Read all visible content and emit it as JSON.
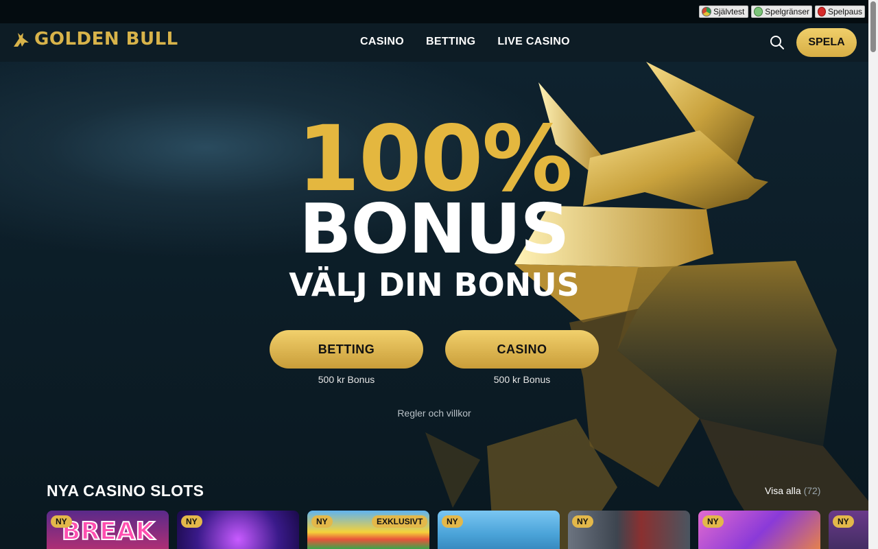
{
  "responsible_gaming": {
    "items": [
      {
        "label": "Självtest",
        "icon": "gauge-icon"
      },
      {
        "label": "Spelgränser",
        "icon": "limits-icon"
      },
      {
        "label": "Spelpaus",
        "icon": "pause-icon"
      }
    ]
  },
  "header": {
    "logo_text": "GOLDEN BULL",
    "nav": [
      "CASINO",
      "BETTING",
      "LIVE CASINO"
    ],
    "cta": "SPELA"
  },
  "hero": {
    "headline": "100%",
    "headline2": "BONUS",
    "subheadline": "VÄLJ DIN BONUS",
    "options": [
      {
        "label": "BETTING",
        "sub": "500 kr Bonus"
      },
      {
        "label": "CASINO",
        "sub": "500 kr Bonus"
      }
    ],
    "terms": "Regler och villkor"
  },
  "slots": {
    "title": "NYA CASINO SLOTS",
    "view_all": "Visa alla",
    "count": "(72)",
    "tiles": [
      {
        "tag": "NY",
        "extra_tag": "",
        "art_text": "BREAK"
      },
      {
        "tag": "NY",
        "extra_tag": "",
        "art_text": ""
      },
      {
        "tag": "NY",
        "extra_tag": "EXKLUSIVT",
        "art_text": ""
      },
      {
        "tag": "NY",
        "extra_tag": "",
        "art_text": ""
      },
      {
        "tag": "NY",
        "extra_tag": "",
        "art_text": ""
      },
      {
        "tag": "NY",
        "extra_tag": "",
        "art_text": ""
      },
      {
        "tag": "NY",
        "extra_tag": "",
        "art_text": ""
      }
    ]
  },
  "colors": {
    "gold": "#e4b73f",
    "background": "#0c1d27",
    "header": "#0d1c25"
  }
}
